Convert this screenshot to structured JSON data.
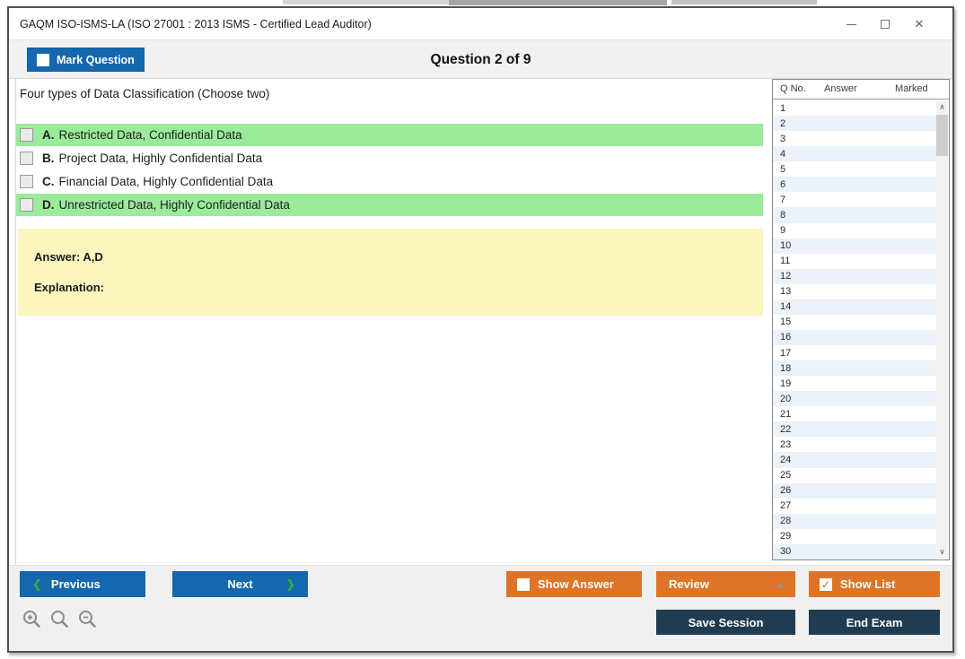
{
  "window": {
    "title": "GAQM ISO-ISMS-LA (ISO 27001 : 2013 ISMS - Certified Lead Auditor)"
  },
  "header": {
    "mark_question_label": "Mark Question",
    "question_counter": "Question 2 of 9"
  },
  "question": {
    "text": "Four types of Data Classification (Choose two)",
    "options": [
      {
        "letter": "A.",
        "text": "Restricted Data, Confidential Data",
        "highlighted": true,
        "checked": false
      },
      {
        "letter": "B.",
        "text": "Project Data, Highly Confidential Data",
        "highlighted": false,
        "checked": false
      },
      {
        "letter": "C.",
        "text": "Financial Data, Highly Confidential Data",
        "highlighted": false,
        "checked": false
      },
      {
        "letter": "D.",
        "text": "Unrestricted Data, Highly Confidential Data",
        "highlighted": true,
        "checked": false
      }
    ],
    "answer_label": "Answer: A,D",
    "explanation_label": "Explanation:"
  },
  "question_list": {
    "columns": [
      "Q No.",
      "Answer",
      "Marked"
    ],
    "rows": [
      "1",
      "2",
      "3",
      "4",
      "5",
      "6",
      "7",
      "8",
      "9",
      "10",
      "11",
      "12",
      "13",
      "14",
      "15",
      "16",
      "17",
      "18",
      "19",
      "20",
      "21",
      "22",
      "23",
      "24",
      "25",
      "26",
      "27",
      "28",
      "29",
      "30"
    ]
  },
  "footer": {
    "previous_label": "Previous",
    "next_label": "Next",
    "show_answer_label": "Show Answer",
    "review_label": "Review",
    "show_list_label": "Show List",
    "save_session_label": "Save Session",
    "end_exam_label": "End Exam"
  },
  "icons": {
    "chevron_left": "❮",
    "chevron_right": "❯",
    "triangle_up": "▲",
    "check": "✓",
    "close": "✕",
    "scroll_up": "∧",
    "scroll_down": "∨"
  },
  "colors": {
    "blue": "#1568ae",
    "orange": "#dd7428",
    "navy": "#1f3c51",
    "green_highlight": "#9aeb9a",
    "yellow_box": "#fbf5be",
    "row_alt": "#ebf2f9",
    "chevron_green": "#31b231",
    "check_orange": "#d95c1a"
  }
}
